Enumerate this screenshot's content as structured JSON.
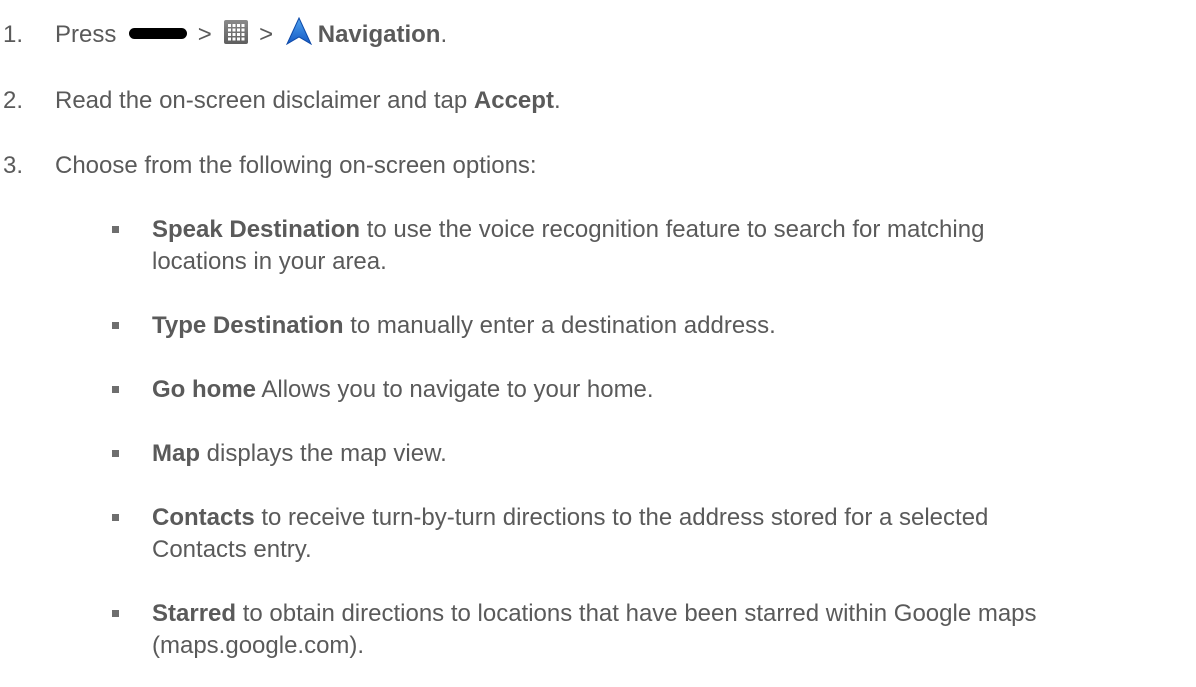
{
  "steps": [
    {
      "number": "1.",
      "press": "Press",
      "sep1": ">",
      "sep2": ">",
      "bold": "Navigation",
      "end": "."
    },
    {
      "number": "2.",
      "text": "Read the on-screen disclaimer and tap ",
      "bold": "Accept",
      "end": "."
    },
    {
      "number": "3.",
      "text": "Choose from the following on-screen options:"
    }
  ],
  "options": [
    {
      "bold": "Speak Destination",
      "text": " to use the voice recognition feature to search for matching",
      "text2": "locations in your area."
    },
    {
      "bold": "Type Destination",
      "text": " to manually enter a destination address."
    },
    {
      "bold": "Go home",
      "text": " Allows you to navigate to your home."
    },
    {
      "bold": "Map",
      "text": " displays the map view."
    },
    {
      "bold": "Contacts",
      "text": " to receive turn-by-turn directions to the address stored for a selected",
      "text2": "Contacts entry."
    },
    {
      "bold": "Starred",
      "text": " to obtain directions to locations that have been starred within Google maps",
      "text2": "(maps.google.com)."
    }
  ],
  "icons": {
    "home_key": "home-key-icon",
    "apps": "apps-grid-icon",
    "navigation": "navigation-arrow-icon"
  },
  "colors": {
    "text": "#5a5a5a",
    "nav_icon": "#1e73d8"
  }
}
